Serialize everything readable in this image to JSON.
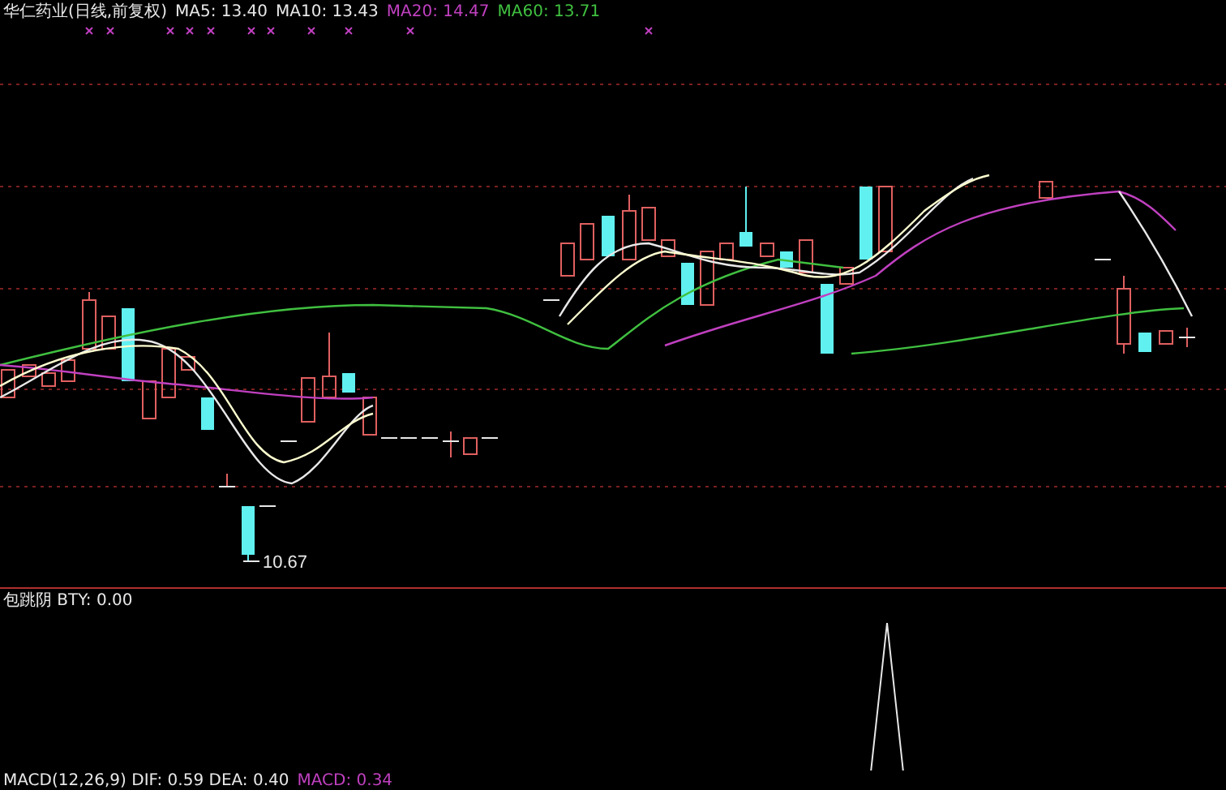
{
  "chart_header": {
    "title": "华仁药业(日线,前复权)",
    "indicators": [
      {
        "label": "MA5: 13.40",
        "color": "#e8e8e8"
      },
      {
        "label": "MA10: 13.43",
        "color": "#e8e8e8"
      },
      {
        "label": "MA20: 14.47",
        "color": "#c040c0"
      },
      {
        "label": "MA60: 13.71",
        "color": "#40c040"
      }
    ]
  },
  "price_chart": {
    "low_price_label": "10.67"
  },
  "indicator_panel": {
    "label": "包跳阴 BTY: 0.00"
  },
  "macd_panel": {
    "indicators": [
      {
        "label": "MACD(12,26,9) DIF: 0.59 DEA: 0.40",
        "color": "#e8e8e8"
      },
      {
        "label": "MACD: 0.34",
        "color": "#c040c0"
      }
    ]
  }
}
